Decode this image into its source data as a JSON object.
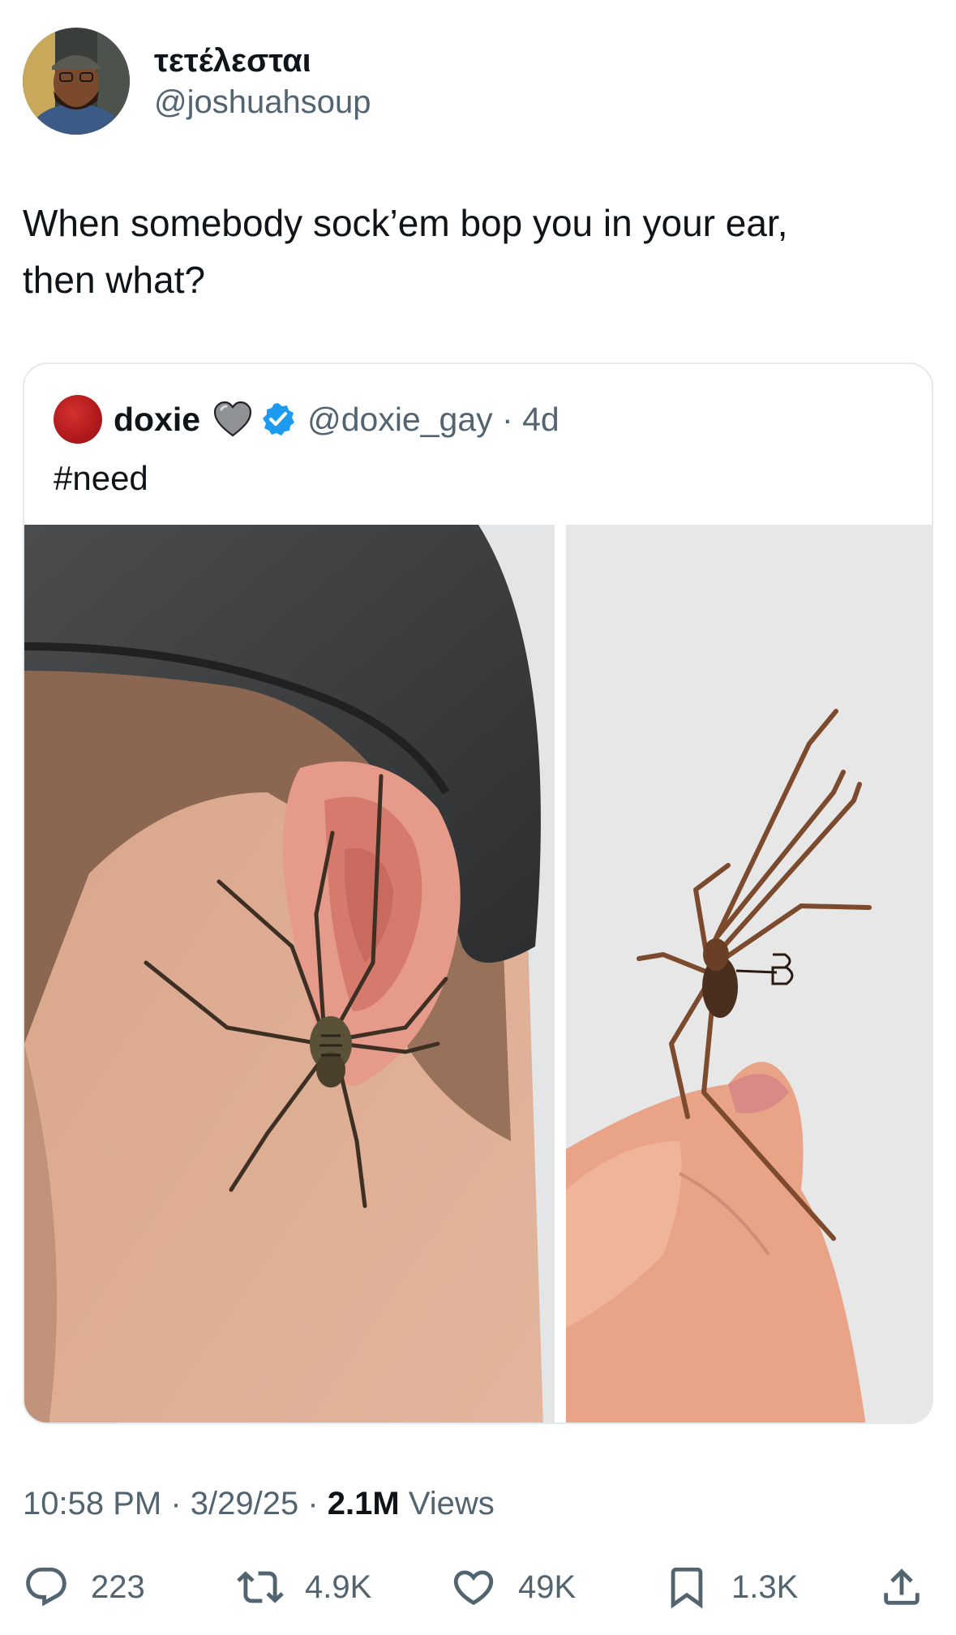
{
  "author": {
    "display_name": "τετέλεσται",
    "handle": "@joshuahsoup"
  },
  "tweet": {
    "text_line1": "When somebody sock’em bop you in your ear,",
    "text_line2": "then what?"
  },
  "quoted": {
    "display_name": "doxie",
    "handle_time": "@doxie_gay · 4d",
    "text": "#need",
    "avatar_color": "#b41b1d",
    "verified_color": "#1d9bf0"
  },
  "meta": {
    "time_date": "10:58 PM · 3/29/25 · ",
    "views_count": "2.1M",
    "views_label": " Views"
  },
  "actions": {
    "replies": "223",
    "reposts": "4.9K",
    "likes": "49K",
    "bookmarks": "1.3K"
  },
  "colors": {
    "text_primary": "#0f1419",
    "text_secondary": "#536471"
  }
}
